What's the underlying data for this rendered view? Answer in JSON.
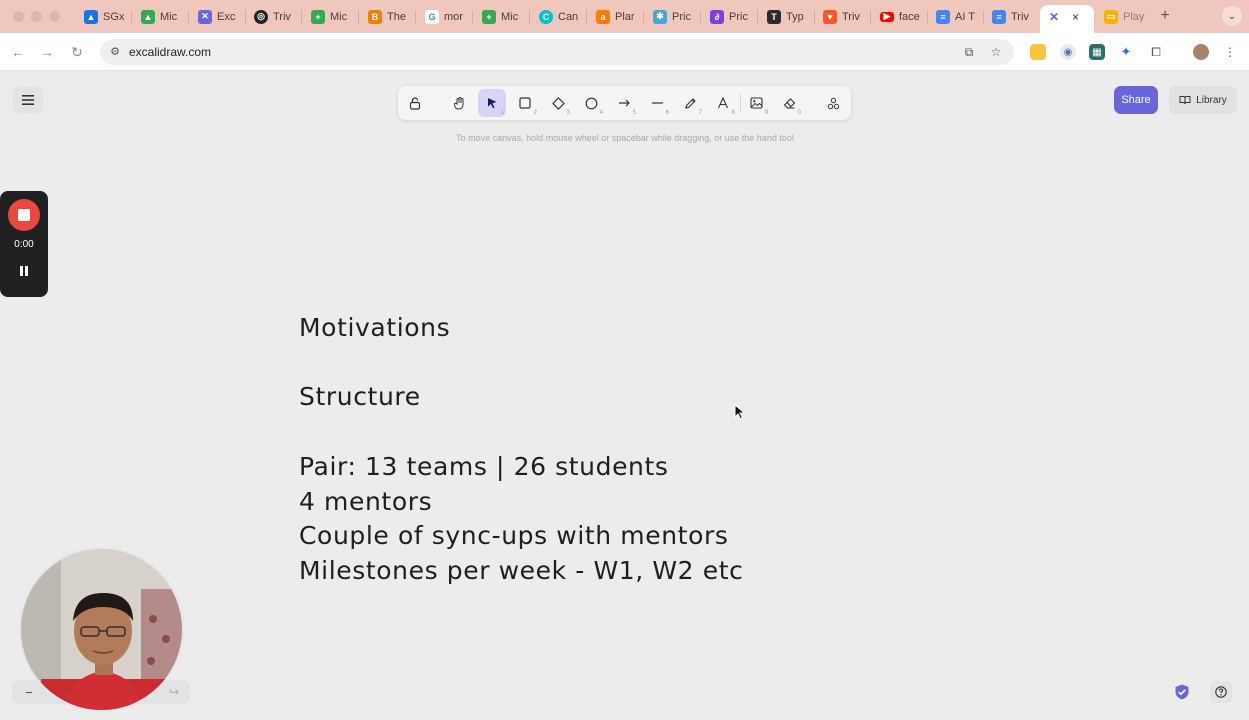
{
  "browser": {
    "tabs": [
      {
        "label": "SGx",
        "icon": "google-drive-icon",
        "color": "#1a73e8"
      },
      {
        "label": "Mic",
        "icon": "google-drive-icon",
        "color": "#34a853"
      },
      {
        "label": "Exc",
        "icon": "excalidraw-icon",
        "color": "#6965db"
      },
      {
        "label": "Triv",
        "icon": "openai-icon",
        "color": "#222222"
      },
      {
        "label": "Mic",
        "icon": "sheets-icon",
        "color": "#34a853"
      },
      {
        "label": "The",
        "icon": "blogger-icon",
        "color": "#f57d00"
      },
      {
        "label": "mor",
        "icon": "google-icon",
        "color": "#4285f4"
      },
      {
        "label": "Mic",
        "icon": "sheets-icon",
        "color": "#34a853"
      },
      {
        "label": "Can",
        "icon": "canva-icon",
        "color": "#00c4cc"
      },
      {
        "label": "Plar",
        "icon": "app-icon",
        "color": "#ff7a00"
      },
      {
        "label": "Pric",
        "icon": "app-icon",
        "color": "#4aa3df"
      },
      {
        "label": "Pric",
        "icon": "app-icon",
        "color": "#7b3fe4"
      },
      {
        "label": "Typ",
        "icon": "typ-icon",
        "color": "#2b2b2b"
      },
      {
        "label": "Triv",
        "icon": "brave-icon",
        "color": "#fb542b"
      },
      {
        "label": "face",
        "icon": "youtube-icon",
        "color": "#ff0000"
      },
      {
        "label": "AI T",
        "icon": "docs-icon",
        "color": "#4285f4"
      },
      {
        "label": "Triv",
        "icon": "docs-icon",
        "color": "#4285f4"
      }
    ],
    "active_tab": {
      "icon": "excalidraw-icon",
      "color": "#6965db",
      "close": "×"
    },
    "last_tab": {
      "label": "Play",
      "icon": "slides-icon",
      "color": "#f4b400"
    },
    "new_tab": "+",
    "url": "excalidraw.com"
  },
  "app": {
    "hint": "To move canvas, hold mouse wheel or spacebar while dragging, or use the hand tool",
    "share_label": "Share",
    "library_label": "Library",
    "accent": "#6965db",
    "tools": [
      {
        "name": "lock",
        "key": ""
      },
      {
        "name": "hand",
        "key": ""
      },
      {
        "name": "selection",
        "key": "1",
        "active": true
      },
      {
        "name": "rectangle",
        "key": "2"
      },
      {
        "name": "diamond",
        "key": "3"
      },
      {
        "name": "ellipse",
        "key": "4"
      },
      {
        "name": "arrow",
        "key": "5"
      },
      {
        "name": "line",
        "key": "6"
      },
      {
        "name": "draw",
        "key": "7"
      },
      {
        "name": "text",
        "key": "8"
      },
      {
        "name": "image",
        "key": "9"
      },
      {
        "name": "eraser",
        "key": "0"
      },
      {
        "name": "more-tools",
        "key": ""
      }
    ]
  },
  "recorder": {
    "time": "0:00"
  },
  "canvas_text": [
    "Motivations",
    "Structure",
    "Pair: 13 teams | 26 students",
    "4 mentors",
    "Couple of sync-ups with mentors",
    "Milestones per week - W1, W2 etc"
  ],
  "zoom": {
    "minus": "−"
  }
}
